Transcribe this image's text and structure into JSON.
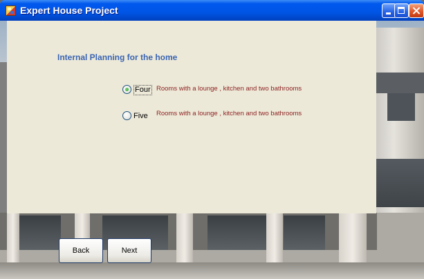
{
  "window": {
    "title": "Expert House Project",
    "controls": {
      "minimize": "minimize-icon",
      "maximize": "maximize-icon",
      "close": "close-icon"
    }
  },
  "main": {
    "heading": "Internal Planning for the home",
    "options": [
      {
        "label": "Four",
        "description": "Rooms with a lounge , kitchen and two bathrooms",
        "selected": true
      },
      {
        "label": "Five",
        "description": "Rooms with a lounge , kitchen and two bathrooms",
        "selected": false
      }
    ]
  },
  "buttons": {
    "back": "Back",
    "next": "Next"
  },
  "colors": {
    "titlebar": "#0055e5",
    "panel": "#ece9d8",
    "heading": "#3a64b2",
    "description": "#8b1e1e"
  }
}
